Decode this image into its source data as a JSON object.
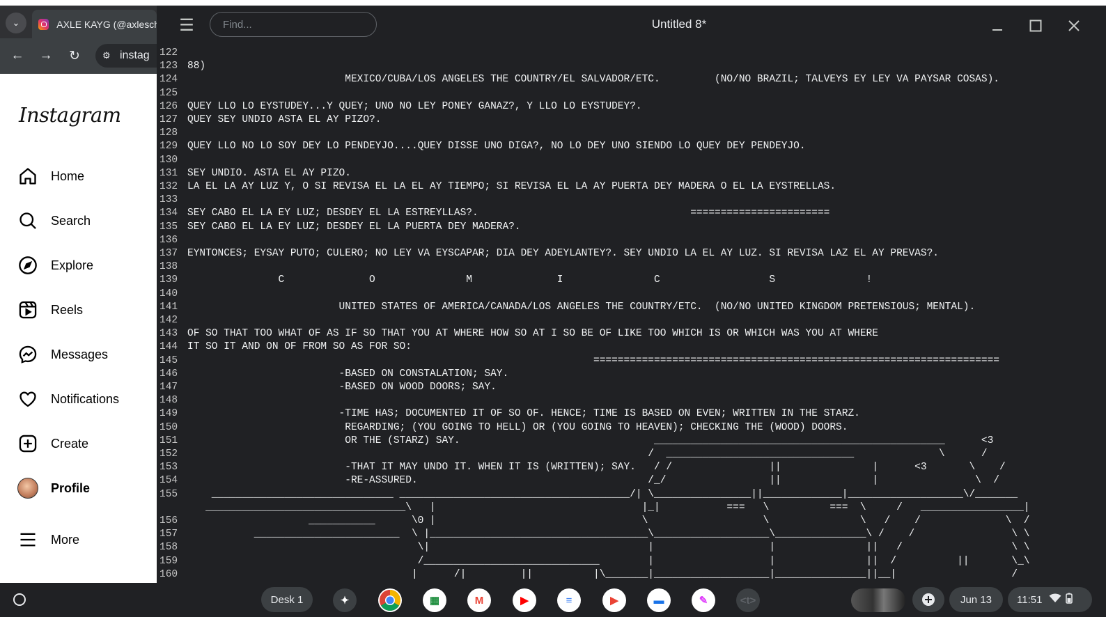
{
  "browser": {
    "tab_title": "AXLE KAYG (@axleschi",
    "address": "instag",
    "icons": [
      "tab-dropdown-icon",
      "instagram-favicon",
      "back-icon",
      "forward-icon",
      "reload-icon",
      "site-settings-icon"
    ]
  },
  "instagram": {
    "logo": "Instagram",
    "nav": [
      {
        "label": "Home",
        "icon": "home-icon"
      },
      {
        "label": "Search",
        "icon": "search-icon"
      },
      {
        "label": "Explore",
        "icon": "explore-compass-icon"
      },
      {
        "label": "Reels",
        "icon": "reels-icon"
      },
      {
        "label": "Messages",
        "icon": "messenger-icon"
      },
      {
        "label": "Notifications",
        "icon": "heart-icon"
      },
      {
        "label": "Create",
        "icon": "plus-square-icon"
      },
      {
        "label": "Profile",
        "icon": "avatar"
      },
      {
        "label": "More",
        "icon": "menu-icon"
      }
    ]
  },
  "editor": {
    "find_placeholder": "Find...",
    "title": "Untitled 8*",
    "lines": [
      {
        "n": "122",
        "t": ""
      },
      {
        "n": "123",
        "t": "88)"
      },
      {
        "n": "124",
        "t": "                          MEXICO/CUBA/LOS ANGELES THE COUNTRY/EL SALVADOR/ETC.         (NO/NO BRAZIL; TALVEYS EY LEY VA PAYSAR COSAS)."
      },
      {
        "n": "125",
        "t": ""
      },
      {
        "n": "126",
        "t": "QUEY LLO LO EYSTUDEY...Y QUEY; UNO NO LEY PONEY GANAZ?, Y LLO LO EYSTUDEY?."
      },
      {
        "n": "127",
        "t": "QUEY SEY UNDIO ASTA EL AY PIZO?."
      },
      {
        "n": "128",
        "t": ""
      },
      {
        "n": "129",
        "t": "QUEY LLO NO LO SOY DEY LO PENDEYJO....QUEY DISSE UNO DIGA?, NO LO DEY UNO SIENDO LO QUEY DEY PENDEYJO."
      },
      {
        "n": "130",
        "t": ""
      },
      {
        "n": "131",
        "t": "SEY UNDIO. ASTA EL AY PIZO."
      },
      {
        "n": "132",
        "t": "LA EL LA AY LUZ Y, O SI REVISA EL LA EL AY TIEMPO; SI REVISA EL LA AY PUERTA DEY MADERA O EL LA EYSTRELLAS."
      },
      {
        "n": "133",
        "t": ""
      },
      {
        "n": "134",
        "t": "SEY CABO EL LA EY LUZ; DESDEY EL LA ESTREYLLAS?.                                   ======================="
      },
      {
        "n": "135",
        "t": "SEY CABO EL LA EY LUZ; DESDEY EL LA PUERTA DEY MADERA?."
      },
      {
        "n": "136",
        "t": ""
      },
      {
        "n": "137",
        "t": "EYNTONCES; EYSAY PUTO; CULERO; NO LEY VA EYSCAPAR; DIA DEY ADEYLANTEY?. SEY UNDIO LA EL AY LUZ. SI REVISA LAZ EL AY PREVAS?."
      },
      {
        "n": "138",
        "t": ""
      },
      {
        "n": "139",
        "t": "               C              O               M              I               C                  S               !"
      },
      {
        "n": "140",
        "t": ""
      },
      {
        "n": "141",
        "t": "                         UNITED STATES OF AMERICA/CANADA/LOS ANGELES THE COUNTRY/ETC.  (NO/NO UNITED KINGDOM PRETENSIOUS; MENTAL)."
      },
      {
        "n": "142",
        "t": ""
      },
      {
        "n": "143",
        "t": "OF SO THAT TOO WHAT OF AS IF SO THAT YOU AT WHERE HOW SO AT I SO BE OF LIKE TOO WHICH IS OR WHICH WAS YOU AT WHERE"
      },
      {
        "n": "144",
        "t": "IT SO IT AND ON OF FROM SO AS FOR SO:"
      },
      {
        "n": "145",
        "t": "                                                                   ==================================================================="
      },
      {
        "n": "146",
        "t": "                         -BASED ON CONSTALATION; SAY."
      },
      {
        "n": "147",
        "t": "                         -BASED ON WOOD DOORS; SAY."
      },
      {
        "n": "148",
        "t": ""
      },
      {
        "n": "149",
        "t": "                         -TIME HAS; DOCUMENTED IT OF SO OF. HENCE; TIME IS BASED ON EVEN; WRITTEN IN THE STARZ."
      },
      {
        "n": "150",
        "t": "                          REGARDING; (YOU GOING TO HELL) OR (YOU GOING TO HEAVEN); CHECKING THE (WOOD) DOORS."
      },
      {
        "n": "151",
        "t": "                          OR THE (STARZ) SAY.                                ________________________________________________      <3"
      },
      {
        "n": "152",
        "t": "                                                                            /  _______________________________              \\      /"
      },
      {
        "n": "153",
        "t": "                          -THAT IT MAY UNDO IT. WHEN IT IS (WRITTEN); SAY.   / /                ||               |      <3       \\    /"
      },
      {
        "n": "154",
        "t": "                          -RE-ASSURED.                                      /_/                 ||               |                \\  /"
      },
      {
        "n": "155",
        "t": "    ______________________________ ______________________________________/| \\________________||_____________|___________________\\/_______"
      },
      {
        "n": "",
        "t": "   _________________________________\\   |                                  |_|           ===   \\          ===  \\     /   _________________|"
      },
      {
        "n": "156",
        "t": "                    ___________      \\0 |                                  \\                   \\               \\   /    /              \\  /"
      },
      {
        "n": "157",
        "t": "           ________________________  \\ |____________________________________\\___________________\\_______________\\ /    /                \\ \\"
      },
      {
        "n": "158",
        "t": "                                      \\|                                    |                   |               ||   /                  \\ \\"
      },
      {
        "n": "159",
        "t": "                                      /_____________________________        |                   |               ||  /          ||       \\_\\"
      },
      {
        "n": "160",
        "t": "                                     |      /|         ||          |\\_______|___________________|_______________||__|                   /"
      }
    ]
  },
  "shelf": {
    "desk_label": "Desk 1",
    "apps": [
      {
        "name": "gemini-app-icon",
        "glyph": "✦",
        "color": "#ffffff"
      },
      {
        "name": "chrome-app-icon",
        "glyph": "",
        "color": "#34a853"
      },
      {
        "name": "google-photos-grid-app-icon",
        "glyph": "▦",
        "color": "#1e8e3e"
      },
      {
        "name": "gmail-app-icon",
        "glyph": "M",
        "color": "#ffffff"
      },
      {
        "name": "youtube-app-icon",
        "glyph": "▶",
        "color": "#ff0000"
      },
      {
        "name": "docs-app-icon",
        "glyph": "≡",
        "color": "#4285f4"
      },
      {
        "name": "play-store-app-icon",
        "glyph": "▶",
        "color": "#ffffff"
      },
      {
        "name": "files-app-icon",
        "glyph": "▬",
        "color": "#1a73e8"
      },
      {
        "name": "canvas-app-icon",
        "glyph": "✎",
        "color": "#e040fb"
      },
      {
        "name": "text-editor-app-icon",
        "glyph": "<t>",
        "color": "#5f6368"
      }
    ],
    "date": "Jun 13",
    "time": "11:51"
  }
}
